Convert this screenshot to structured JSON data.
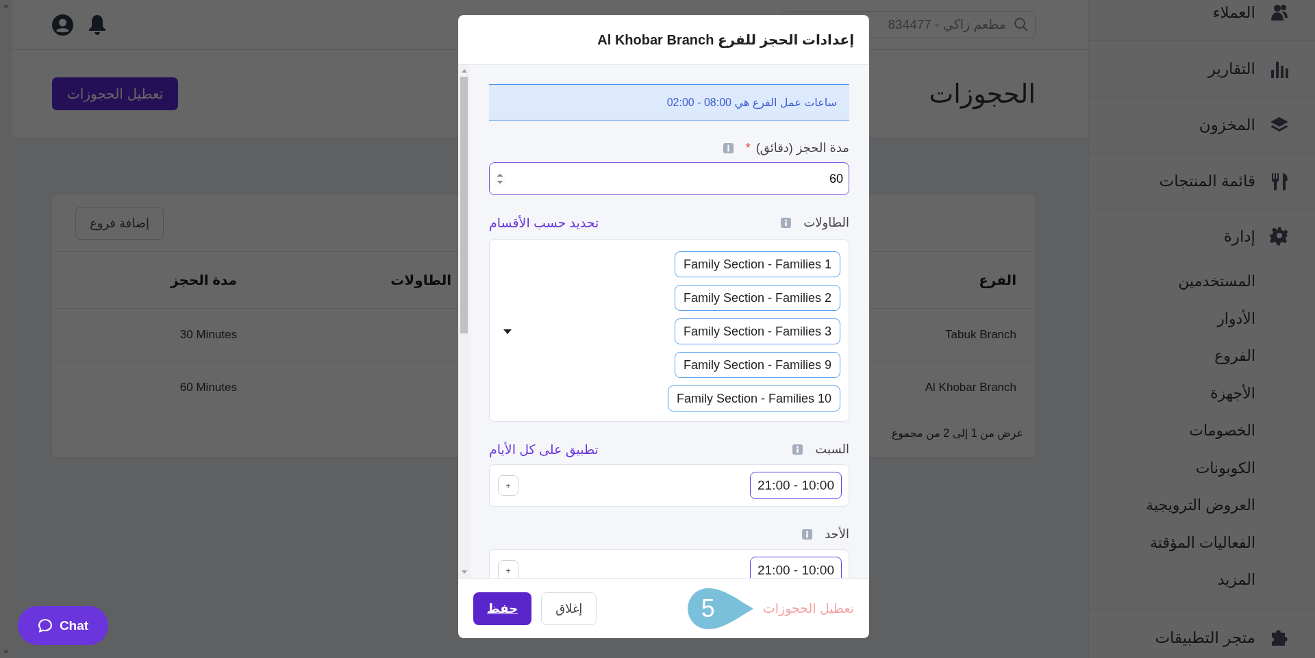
{
  "header": {
    "search": {
      "placeholder": "مطعم زاكي - 834477"
    }
  },
  "page": {
    "title": "الحجوزات",
    "disable_button": "تعطيل الحجوزات"
  },
  "branches_card": {
    "add_button": "إضافة فروع",
    "columns": [
      "الفرع",
      "الطاولات",
      "مدة الحجز"
    ],
    "rows": [
      {
        "branch": "Tabuk Branch",
        "duration": "30 Minutes"
      },
      {
        "branch": "Al Khobar Branch",
        "duration": "60 Minutes"
      }
    ],
    "pagination_text": "عرض من 1 إلى 2 من مجموع"
  },
  "sidebar": {
    "items": [
      {
        "label": "العملاء"
      },
      {
        "label": "التقارير"
      },
      {
        "label": "المخزون"
      },
      {
        "label": "قائمة المنتجات"
      },
      {
        "label": "إدارة",
        "children": [
          {
            "label": "المستخدمين"
          },
          {
            "label": "الأدوار"
          },
          {
            "label": "الفروع"
          },
          {
            "label": "الأجهزة"
          },
          {
            "label": "الخصومات"
          },
          {
            "label": "الكوبونات"
          },
          {
            "label": "العروض الترويجية"
          },
          {
            "label": "الفعاليات المؤقتة"
          },
          {
            "label": "المزيد"
          }
        ]
      },
      {
        "label": "متجر التطبيقات"
      }
    ]
  },
  "chat_button": {
    "label": "Chat"
  },
  "modal": {
    "title": "إعدادات الحجز للفرع Al Khobar Branch",
    "notice": "ساعات عمل الفرع هي 08:00 - 02:00",
    "duration_field": {
      "label": "مدة الحجز (دقائق)",
      "required_mark": "*",
      "value": "60"
    },
    "tables": {
      "label": "الطاولات",
      "link": "تحديد حسب الأقسام",
      "selected_tables": [
        "Family Section - Families 1",
        "Family Section - Families 2",
        "Family Section - Families 3",
        "Family Section - Families 9",
        "Family Section - Families 10"
      ]
    },
    "days": [
      {
        "label": "السبت",
        "link": "تطبيق على كل الأيام",
        "slots": [
          "21:00 - 10:00"
        ],
        "add_button": "+"
      },
      {
        "label": "الأحد",
        "slots": [
          "21:00 - 10:00"
        ],
        "add_button": "+"
      }
    ],
    "footer": {
      "disable_link": "تعطيل الحجوزات",
      "step_marker": "5",
      "close_button": "إغلاق",
      "save_button": "حفظ"
    }
  }
}
